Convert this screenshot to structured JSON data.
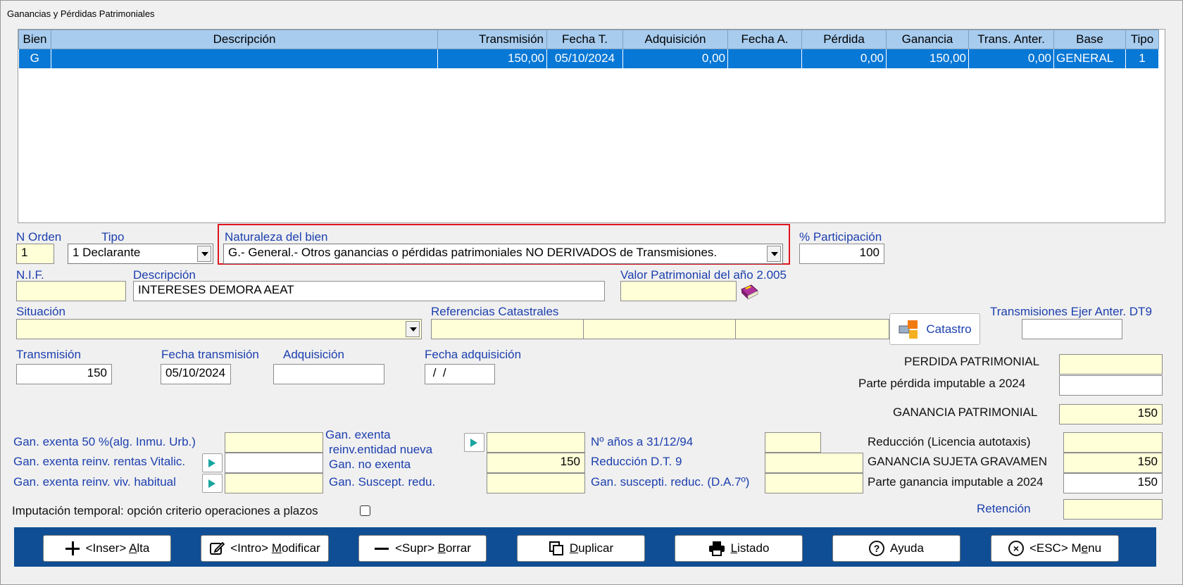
{
  "window": {
    "title": "Ganancias y Pérdidas Patrimoniales"
  },
  "grid": {
    "columns": [
      "Bien",
      "Descripción",
      "Transmisión",
      "Fecha T.",
      "Adquisición",
      "Fecha A.",
      "Pérdida",
      "Ganancia",
      "Trans. Anter.",
      "Base",
      "Tipo"
    ],
    "rows": [
      [
        "G",
        "",
        "150,00",
        "05/10/2024",
        "0,00",
        "",
        "0,00",
        "150,00",
        "0,00",
        "GENERAL",
        "1"
      ]
    ]
  },
  "form": {
    "n_orden": {
      "label": "N Orden",
      "value": "1"
    },
    "tipo": {
      "label": "Tipo",
      "value": "1 Declarante"
    },
    "naturaleza": {
      "label": "Naturaleza del bien",
      "value": "G.- General.- Otros ganancias o pérdidas patrimoniales NO DERIVADOS de Transmisiones."
    },
    "participacion": {
      "label": "% Participación",
      "value": "100"
    },
    "nif": {
      "label": "N.I.F.",
      "value": ""
    },
    "descripcion": {
      "label": "Descripción",
      "value": "INTERESES DEMORA AEAT"
    },
    "valor_patrimonial": {
      "label": "Valor Patrimonial del año 2.005",
      "value": ""
    },
    "situacion": {
      "label": "Situación",
      "value": ""
    },
    "referencias": {
      "label": "Referencias Catastrales"
    },
    "catastro_button": "Catastro",
    "trans_ejer": {
      "label": "Transmisiones Ejer Anter. DT9",
      "value": ""
    },
    "transmision": {
      "label": "Transmisión",
      "value": "150"
    },
    "fecha_transmision": {
      "label": "Fecha transmisión",
      "value": "05/10/2024"
    },
    "adquisicion": {
      "label": "Adquisición",
      "value": ""
    },
    "fecha_adquisicion": {
      "label": "Fecha adquisición",
      "value": " /  /"
    },
    "perdida_patrimonial": {
      "label": "PERDIDA PATRIMONIAL",
      "value": ""
    },
    "parte_perdida": {
      "label": "Parte pérdida imputable a 2024",
      "value": ""
    },
    "ganancia_patrimonial": {
      "label": "GANANCIA PATRIMONIAL",
      "value": "150"
    },
    "gan_exenta_50": {
      "label": "Gan. exenta 50 %(alg. Inmu. Urb.)",
      "value": ""
    },
    "gan_exenta_vitalic": {
      "label": "Gan. exenta reinv. rentas Vitalic.",
      "value": ""
    },
    "gan_exenta_viv": {
      "label": "Gan. exenta reinv. viv. habitual",
      "value": ""
    },
    "gan_exenta_entidad": {
      "label_1": "Gan. exenta",
      "label_2": "reinv.entidad nueva",
      "value": ""
    },
    "gan_no_exenta": {
      "label": "Gan. no exenta",
      "value": "150"
    },
    "gan_suscept": {
      "label": "Gan. Suscept. redu.",
      "value": ""
    },
    "anos_9412": {
      "label": "Nº años a 31/12/94",
      "value": ""
    },
    "reduccion_dt9": {
      "label": "Reducción D.T. 9",
      "value": ""
    },
    "gan_suscepti_da7": {
      "label": "Gan. suscepti. reduc. (D.A.7º)",
      "value": ""
    },
    "reduccion_licencia": {
      "label": "Reducción (Licencia autotaxis)",
      "value": ""
    },
    "ganancia_sujeta": {
      "label": "GANANCIA SUJETA GRAVAMEN",
      "value": "150"
    },
    "parte_ganancia": {
      "label": "Parte ganancia imputable a 2024",
      "value": "150"
    },
    "imputacion": {
      "label": "Imputación temporal: opción criterio operaciones a plazos"
    },
    "retencion": {
      "label": "Retención",
      "value": ""
    }
  },
  "toolbar": {
    "alta": {
      "pre": "<Inser> ",
      "key": "A",
      "rest": "lta"
    },
    "modificar": {
      "pre": "<Intro> ",
      "key": "M",
      "rest": "odificar"
    },
    "borrar": {
      "pre": "<Supr> ",
      "key": "B",
      "rest": "orrar"
    },
    "duplicar": {
      "pre": "",
      "key": "D",
      "rest": "uplicar"
    },
    "listado": {
      "pre": "",
      "key": "L",
      "rest": "istado"
    },
    "ayuda": {
      "label": "Ayuda"
    },
    "menu": {
      "pre": "<ESC> M",
      "key": "e",
      "rest": "nu"
    }
  }
}
